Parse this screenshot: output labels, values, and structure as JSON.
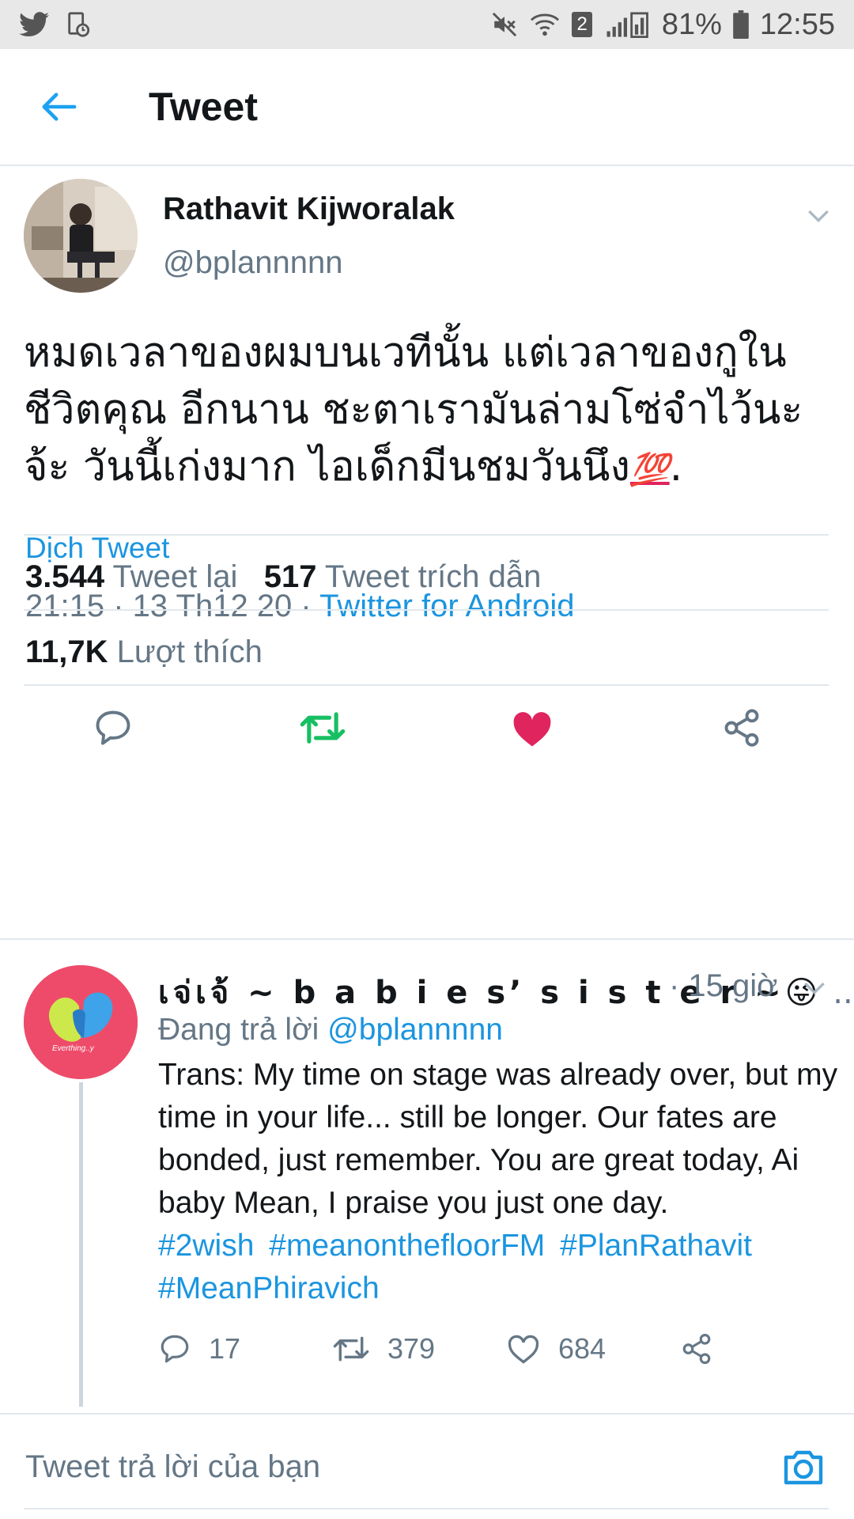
{
  "status_bar": {
    "left_icons": [
      "twitter-icon",
      "sync-icon"
    ],
    "right_icons": [
      "mute-icon",
      "wifi-icon",
      "signal-icon"
    ],
    "wifi_badge": "2",
    "battery": "81%",
    "time": "12:55"
  },
  "header": {
    "back_icon": "arrow-left-icon",
    "title": "Tweet"
  },
  "tweet": {
    "author_name": "Rathavit Kijworalak",
    "author_handle": "@bplannnnn",
    "text": "หมดเวลาของผมบนเวทีนั้น แต่เวลาของกูในชีวิตคุณ อีกนาน ชะตาเรามันล่ามโซ่จำไว้นะจ้ะ วันนี้เก่งมาก ไอเด็กมีนชมวันนึง",
    "text_emoji": "💯",
    "text_end": ".",
    "translate_label": "Dịch Tweet",
    "time": "21:15 · 13 Th12 20 · ",
    "source": "Twitter for Android",
    "retweets_count": "3.544",
    "retweets_label": "Tweet lại",
    "quotes_count": "517",
    "quotes_label": "Tweet trích dẫn",
    "likes_count": "11,7K",
    "likes_label": "Lượt thích",
    "actions": [
      "reply-icon",
      "retweet-icon",
      "like-icon",
      "share-icon"
    ],
    "colors": {
      "retweet": "#17bf63",
      "like": "#e0245e",
      "link": "#1b95e0"
    }
  },
  "reply": {
    "author_name": "เจ่เจ้ ~ b a b i e s’ s i s t e r ~",
    "author_emoji": "😜",
    "ellipsis": "...",
    "time": "· 15 giờ",
    "replying_prefix": "Đang trả lời",
    "replying_handle": "@bplannnnn",
    "text": "Trans: My time on stage was already over, but my time in your life... still be longer. Our fates are bonded, just remember. You are great today, Ai baby Mean, I praise you just one day.",
    "hashtags": [
      "#2wish",
      "#meanonthefloorFM",
      "#PlanRathavit",
      "#MeanPhiravich"
    ],
    "reply_count": "17",
    "retweet_count": "379",
    "like_count": "684",
    "avatar_caption": "Everthing..y"
  },
  "compose": {
    "placeholder": "Tweet trả lời của bạn",
    "camera_icon": "camera-icon"
  }
}
